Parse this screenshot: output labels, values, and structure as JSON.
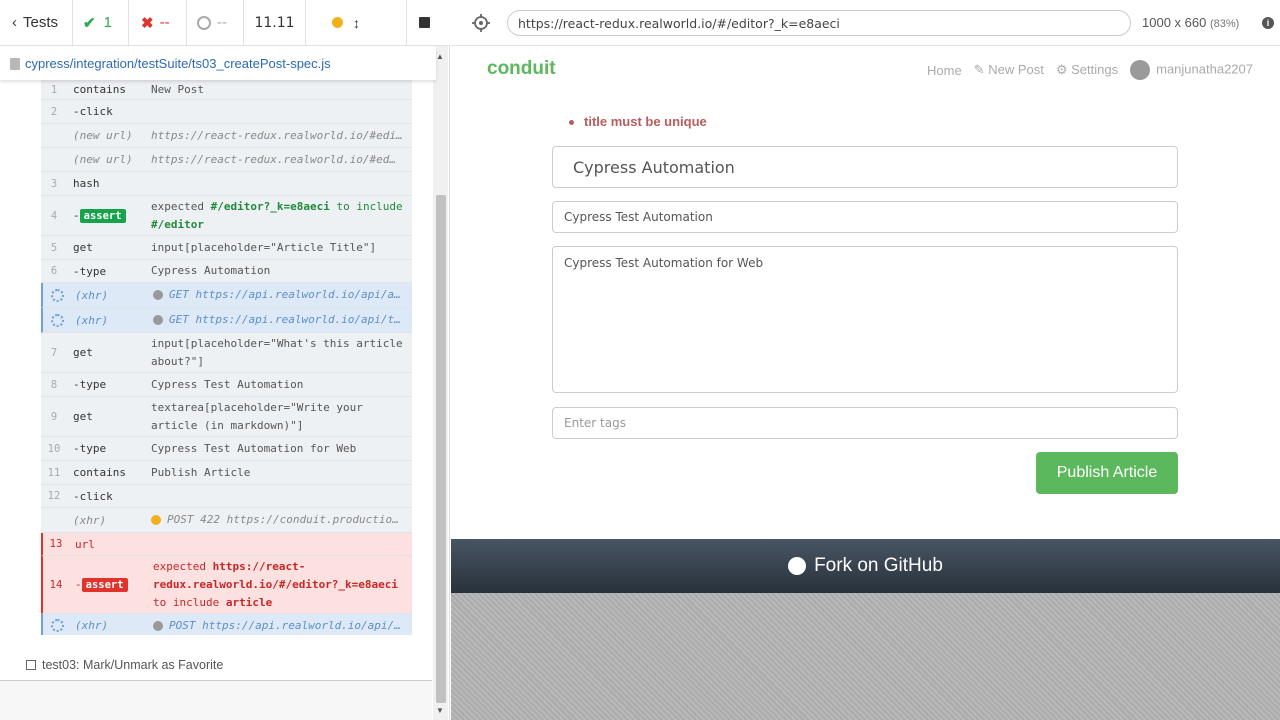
{
  "reporter": {
    "tests_label": "Tests",
    "passed": "1",
    "failed": "--",
    "pending": "--",
    "duration": "11.11",
    "spec_path": "cypress/integration/testSuite/ts03_createPost-spec.js",
    "next_test": "test03: Mark/Unmark as Favorite"
  },
  "commands": [
    {
      "num": "1",
      "cmd": "contains",
      "msg": "New Post"
    },
    {
      "num": "2",
      "cmd": "-click",
      "msg": ""
    },
    {
      "num": "",
      "cmd": "(new url)",
      "msg": "https://react-redux.realworld.io/#edi…"
    },
    {
      "num": "",
      "cmd": "(new url)",
      "msg": "https://react-redux.realworld.io/#ed…"
    },
    {
      "num": "3",
      "cmd": "hash",
      "msg": ""
    },
    {
      "num": "4",
      "cmd": "-",
      "badge": "assert",
      "msg_a": "expected ",
      "msg_b": "#/editor?_k=e8aeci",
      "msg_c": " to include ",
      "msg_d": "#/editor"
    },
    {
      "num": "5",
      "cmd": "get",
      "msg": "input[placeholder=\"Article Title\"]"
    },
    {
      "num": "6",
      "cmd": "-type",
      "msg": "Cypress Automation"
    },
    {
      "num": "",
      "cmd": "(xhr)",
      "msg": "GET https://api.realworld.io/api/a…"
    },
    {
      "num": "",
      "cmd": "(xhr)",
      "msg": "GET https://api.realworld.io/api/t…"
    },
    {
      "num": "7",
      "cmd": "get",
      "msg": "input[placeholder=\"What's this article about?\"]"
    },
    {
      "num": "8",
      "cmd": "-type",
      "msg": "Cypress Test Automation"
    },
    {
      "num": "9",
      "cmd": "get",
      "msg": "textarea[placeholder=\"Write your article (in markdown)\"]"
    },
    {
      "num": "10",
      "cmd": "-type",
      "msg": "Cypress Test Automation for Web"
    },
    {
      "num": "11",
      "cmd": "contains",
      "msg": "Publish Article"
    },
    {
      "num": "12",
      "cmd": "-click",
      "msg": ""
    },
    {
      "num": "",
      "cmd": "(xhr)",
      "msg": "POST 422 https://conduit.productio…"
    },
    {
      "num": "13",
      "cmd": "url",
      "msg": ""
    },
    {
      "num": "14",
      "cmd": "-",
      "badge": "assert",
      "msg_a": "expected ",
      "msg_b": "https://react-redux.realworld.io/#/editor?_k=e8aeci",
      "msg_c": " to include ",
      "msg_d": "article"
    },
    {
      "num": "",
      "cmd": "(xhr)",
      "msg": "POST https://api.realworld.io/api/…"
    }
  ],
  "browser": {
    "url": "https://react-redux.realworld.io/#/editor?_k=e8aeci",
    "viewport": "1000 x 660",
    "scale": "(83%)"
  },
  "app": {
    "brand": "conduit",
    "nav": [
      "Home",
      "New Post",
      "Settings"
    ],
    "username": "manjunatha2207",
    "error": "title must be unique",
    "title_value": "Cypress Automation",
    "about_value": "Cypress Test Automation",
    "body_value": "Cypress Test Automation for Web",
    "tags_placeholder": "Enter tags",
    "publish_label": "Publish Article",
    "fork_label": "Fork on GitHub",
    "accent_color": "#5cb85c"
  }
}
